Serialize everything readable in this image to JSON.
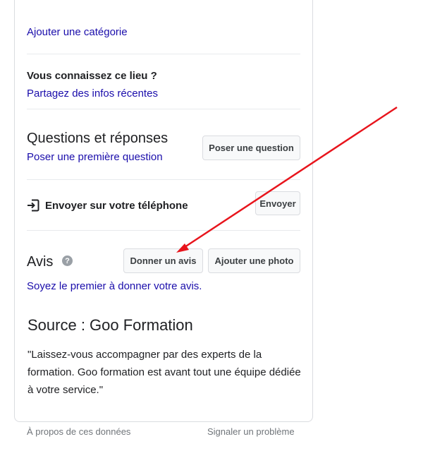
{
  "panel": {
    "add_category_link": "Ajouter une catégorie",
    "know_place": {
      "title": "Vous connaissez ce lieu ?",
      "link": "Partagez des infos récentes"
    },
    "qa": {
      "title": "Questions et réponses",
      "link": "Poser une première question",
      "button": "Poser une question"
    },
    "send": {
      "icon": "send-to-phone-icon",
      "label": "Envoyer sur votre téléphone",
      "button": "Envoyer"
    },
    "reviews": {
      "title": "Avis",
      "help_icon": "?",
      "write_button": "Donner un avis",
      "photo_button": "Ajouter une photo",
      "first_link": "Soyez le premier à donner votre avis."
    },
    "source": {
      "title": "Source : Goo Formation",
      "quote": "\"Laissez-vous accompagner par des experts de la formation. Goo formation est avant tout une équipe dédiée à votre service.\""
    }
  },
  "footer": {
    "about_link": "À propos de ces données",
    "report_link": "Signaler un problème"
  },
  "colors": {
    "link": "#1a0dab",
    "arrow": "#e8141c"
  }
}
